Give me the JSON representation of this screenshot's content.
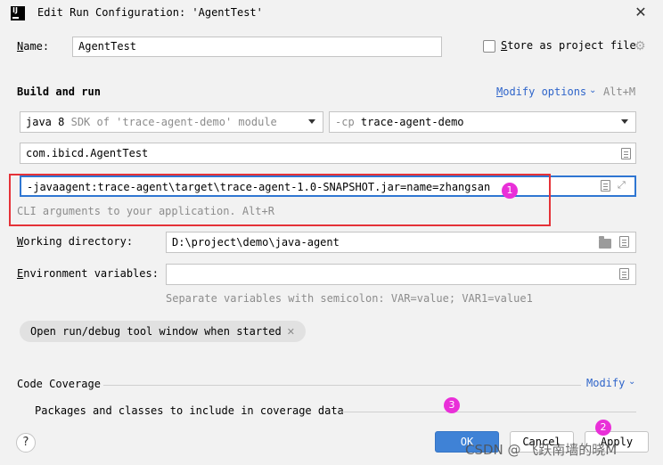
{
  "window": {
    "title": "Edit Run Configuration: 'AgentTest'",
    "app_icon_text": "IJ"
  },
  "name_row": {
    "label": "Name:",
    "value": "AgentTest",
    "store_label": "Store as project file",
    "store_checked": false
  },
  "build": {
    "section_title": "Build and run",
    "modify_options": "Modify options",
    "modify_shortcut": "Alt+M",
    "jdk_main": "java 8",
    "jdk_detail": "SDK of 'trace-agent-demo' module",
    "cp_flag": "-cp",
    "cp_value": "trace-agent-demo",
    "main_class": "com.ibicd.AgentTest",
    "vm_options": "-javaagent:trace-agent\\target\\trace-agent-1.0-SNAPSHOT.jar=name=zhangsan",
    "program_args_hint": "CLI arguments to your application. Alt+R"
  },
  "working_dir": {
    "label": "Working directory:",
    "value": "D:\\project\\demo\\java-agent"
  },
  "env_vars": {
    "label": "Environment variables:",
    "value": "",
    "hint": "Separate variables with semicolon: VAR=value; VAR1=value1"
  },
  "chip": {
    "label": "Open run/debug tool window when started"
  },
  "coverage": {
    "title": "Code Coverage",
    "modify": "Modify",
    "packages_label": "Packages and classes to include in coverage data"
  },
  "footer": {
    "help": "?",
    "ok": "OK",
    "cancel": "Cancel",
    "apply": "Apply"
  },
  "annotations": {
    "badge1": "1",
    "badge2": "2",
    "badge3": "3"
  },
  "watermark": "CSDN @ 飞跃南墙的晓M",
  "colors": {
    "accent": "#3f82d6",
    "link": "#2f65ca",
    "highlight_border": "#e53238",
    "badge": "#e92fd8"
  }
}
